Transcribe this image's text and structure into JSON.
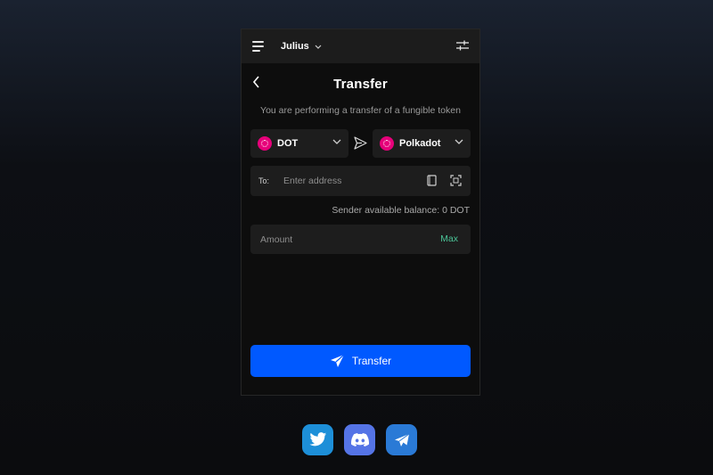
{
  "header": {
    "account_name": "Julius"
  },
  "page": {
    "title": "Transfer",
    "subtitle": "You are performing a transfer of a fungible token"
  },
  "token_select": {
    "selected": "DOT"
  },
  "chain_select": {
    "selected": "Polkadot"
  },
  "address": {
    "label": "To:",
    "placeholder": "Enter address",
    "value": ""
  },
  "balance": {
    "text": "Sender available balance: 0 DOT"
  },
  "amount": {
    "placeholder": "Amount",
    "value": "",
    "max_label": "Max"
  },
  "transfer_button": {
    "label": "Transfer"
  },
  "socials": {
    "items": [
      "twitter",
      "discord",
      "telegram"
    ]
  },
  "colors": {
    "accent": "#0059ff",
    "polkadot": "#e6007a",
    "max_green": "#4ac296",
    "panel_bg": "#0d0d0d",
    "field_bg": "#1d1d1d"
  },
  "icons": [
    "menu-icon",
    "chevron-down-icon",
    "settings-sliders-icon",
    "back-arrow-icon",
    "polkadot-token-icon",
    "send-icon",
    "address-book-icon",
    "scan-icon",
    "twitter-icon",
    "discord-icon",
    "telegram-icon"
  ]
}
